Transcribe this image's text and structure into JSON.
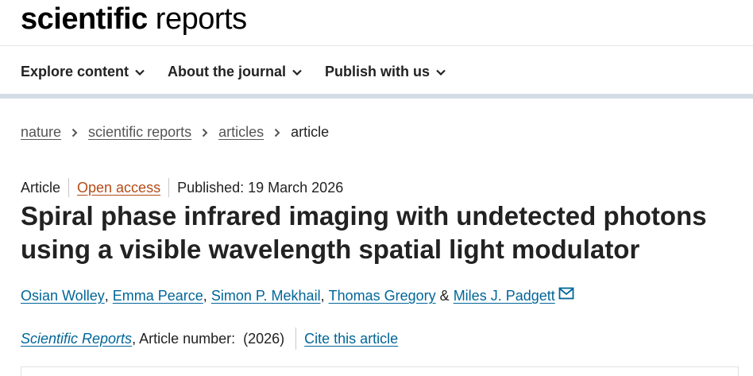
{
  "header": {
    "logo_bold": "scientific",
    "logo_light": "reports"
  },
  "nav": {
    "items": [
      {
        "label": "Explore content"
      },
      {
        "label": "About the journal"
      },
      {
        "label": "Publish with us"
      }
    ]
  },
  "breadcrumb": {
    "items": [
      "nature",
      "scientific reports",
      "articles"
    ],
    "current": "article"
  },
  "article": {
    "type": "Article",
    "access": "Open access",
    "published": "Published: 19 March 2026",
    "title": "Spiral phase infrared imaging with undetected photons using a visible wavelength spatial light modulator",
    "authors": [
      "Osian Wolley",
      "Emma Pearce",
      "Simon P. Mekhail",
      "Thomas Gregory",
      "Miles J. Padgett"
    ],
    "author_separator": ",",
    "author_last_separator": "&",
    "journal": "Scientific Reports",
    "article_number_text": ", Article number:  (2026)",
    "cite_label": "Cite this article"
  },
  "colors": {
    "link": "#006699",
    "open_access": "#b44b16",
    "nav_border": "#d4dde5"
  },
  "icons": [
    "chevron-down-icon",
    "chevron-right-icon",
    "mail-icon"
  ]
}
